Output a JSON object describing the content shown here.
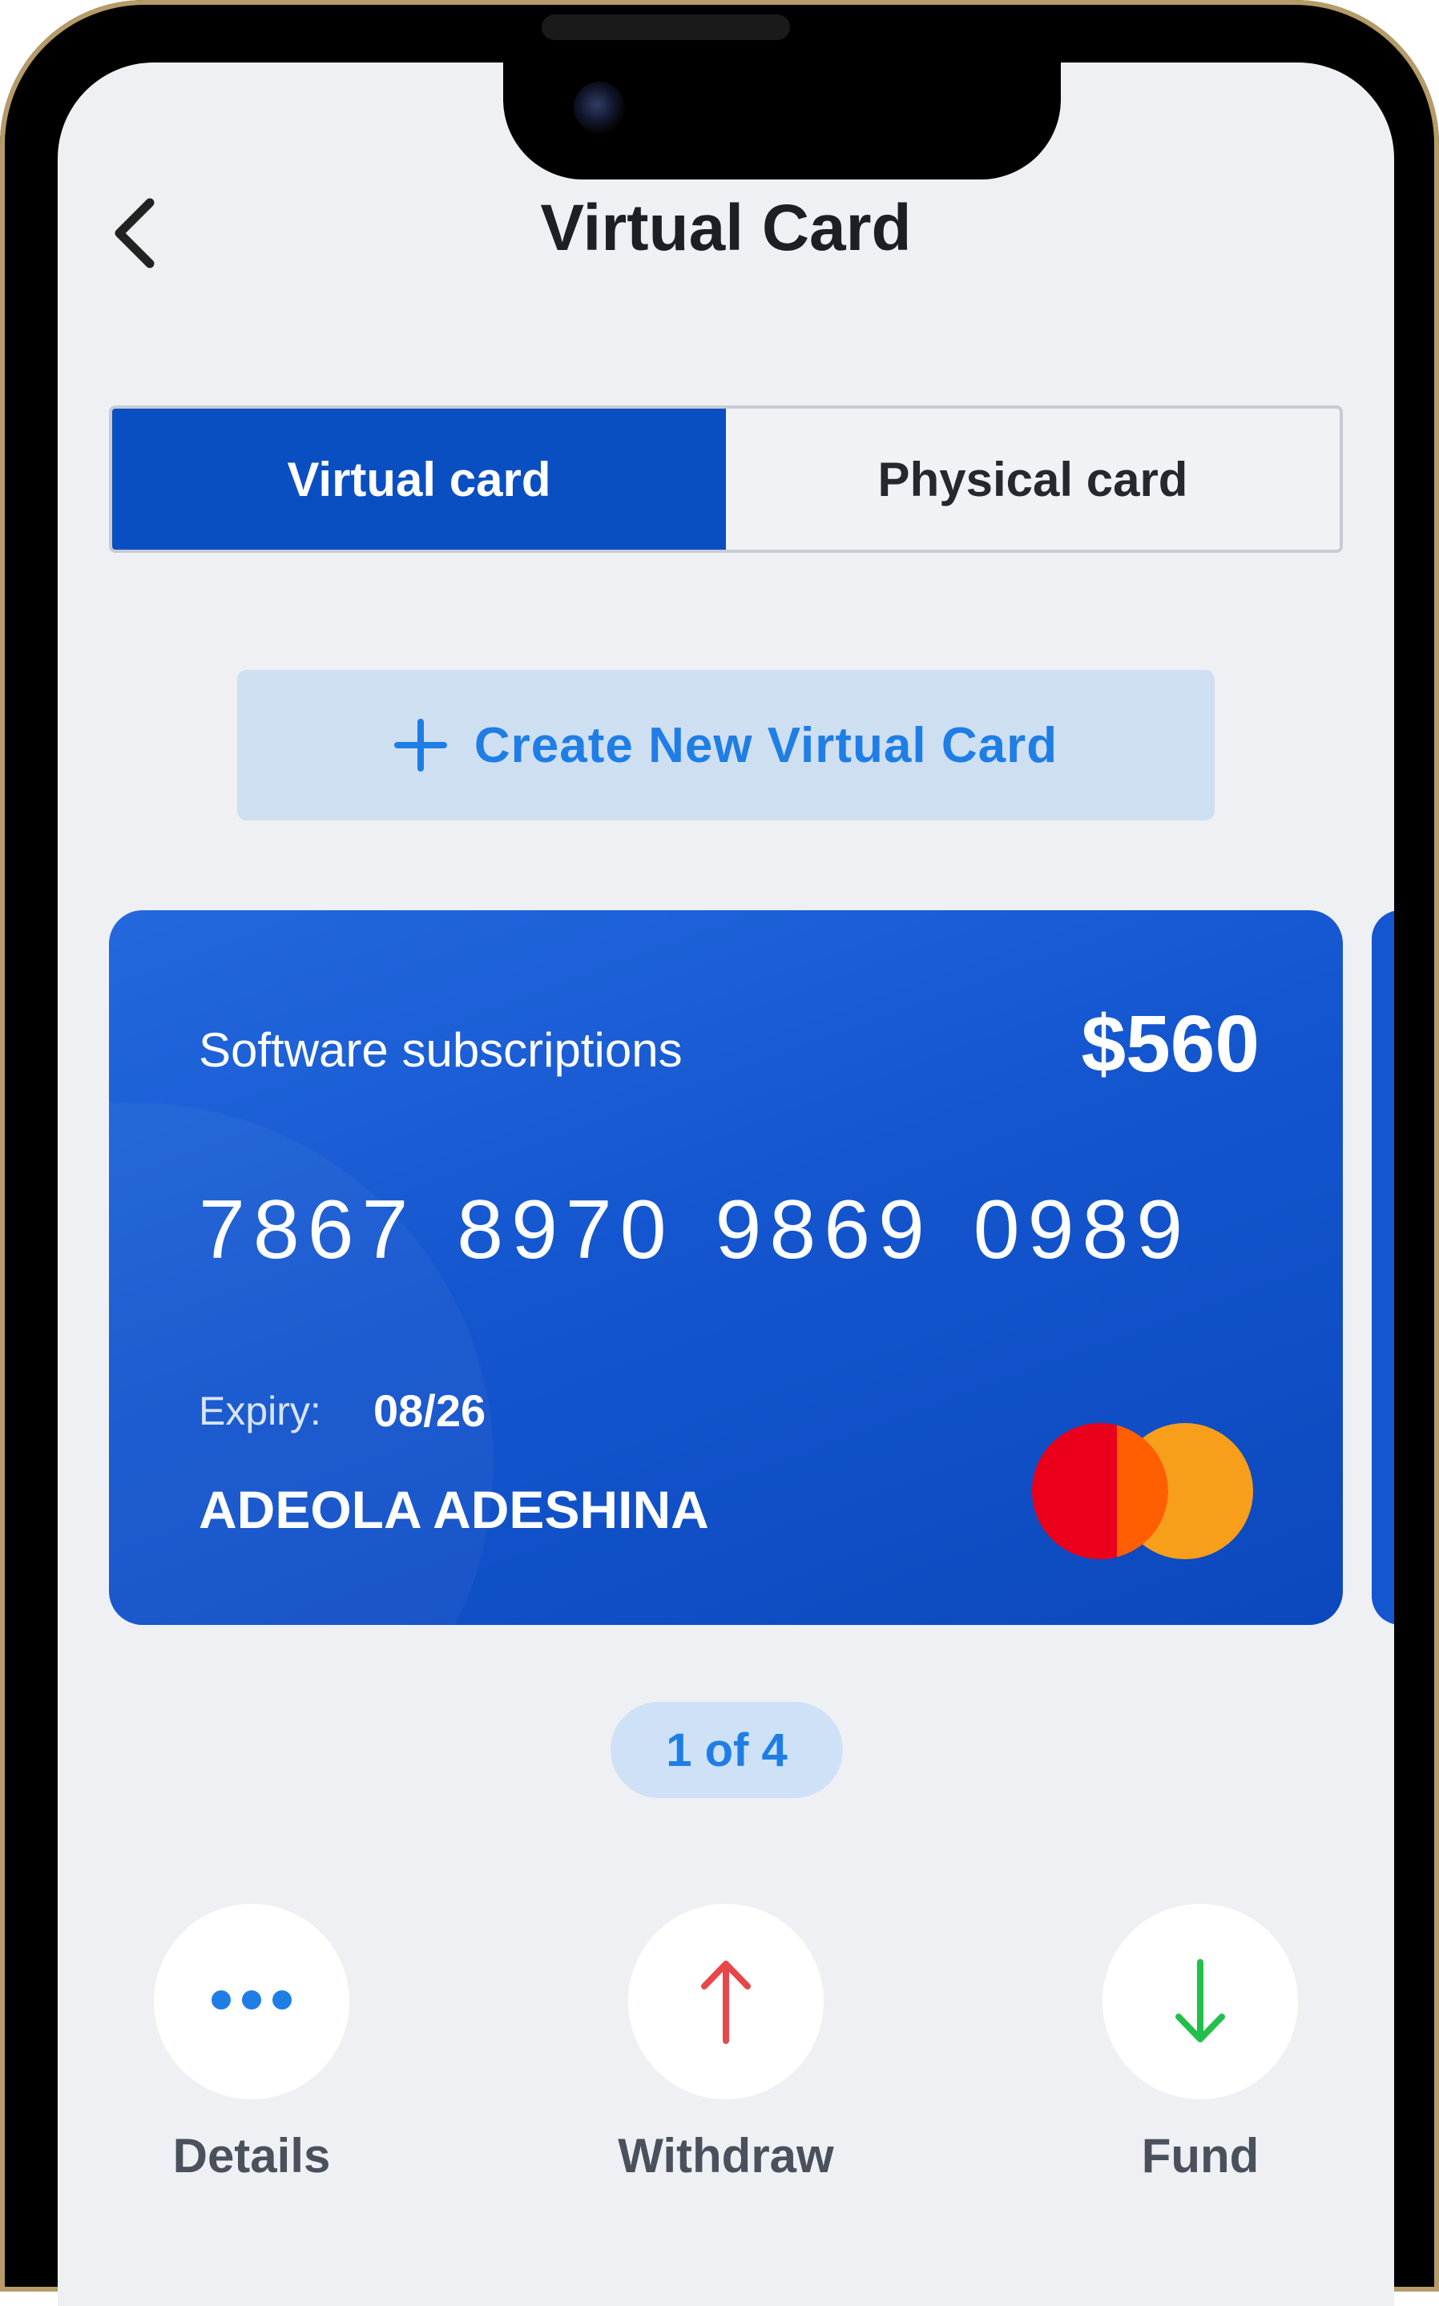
{
  "header": {
    "title": "Virtual Card",
    "back_icon": "chevron-left-icon"
  },
  "tabs": [
    {
      "label": "Virtual card",
      "active": true
    },
    {
      "label": "Physical card",
      "active": false
    }
  ],
  "create_button": {
    "icon": "plus-icon",
    "label": "Create New Virtual Card"
  },
  "card": {
    "label": "Software subscriptions",
    "amount": "$560",
    "number": "7867 8970 9869 0989",
    "expiry_label": "Expiry:",
    "expiry_value": "08/26",
    "holder": "ADEOLA ADESHINA",
    "network_icon": "mastercard-logo"
  },
  "pager": "1 of 4",
  "actions": [
    {
      "label": "Details",
      "icon": "more-dots-icon",
      "color": "#1e7ee6"
    },
    {
      "label": "Withdraw",
      "icon": "arrow-up-icon",
      "color": "#e8474a"
    },
    {
      "label": "Fund",
      "icon": "arrow-down-icon",
      "color": "#22c04b"
    }
  ],
  "colors": {
    "accent": "#0a4fc2",
    "link": "#1e7ee6",
    "background": "#eff0f4"
  }
}
